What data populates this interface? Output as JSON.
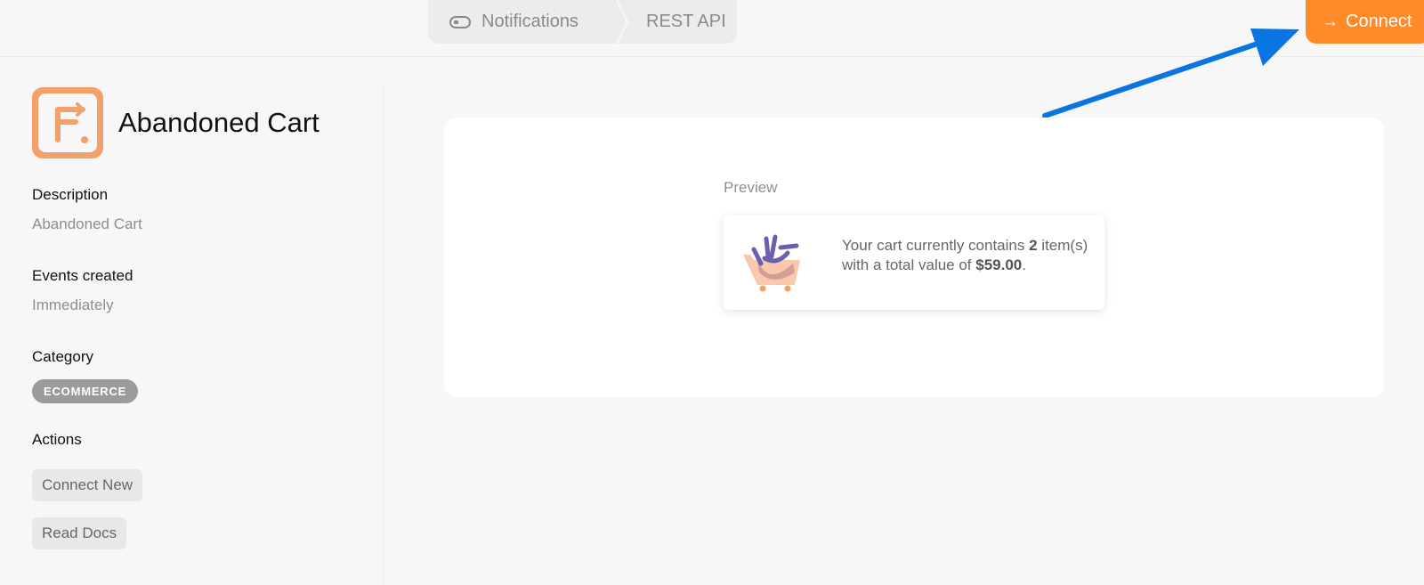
{
  "breadcrumb": {
    "items": [
      {
        "label": "Notifications",
        "icon": "toggle-icon"
      },
      {
        "label": "REST API"
      }
    ]
  },
  "header": {
    "connect_label": "Connect",
    "connect_icon": "arrow-right-icon",
    "accent_color": "#ff8a2a"
  },
  "annotation": {
    "color": "#0a74e0"
  },
  "sidebar": {
    "title": "Abandoned Cart",
    "logo_icon": "brand-logo",
    "description_label": "Description",
    "description_value": "Abandoned Cart",
    "events_label": "Events created",
    "events_value": "Immediately",
    "category_label": "Category",
    "category_badge": "ECOMMERCE",
    "actions_label": "Actions",
    "actions": [
      {
        "label": "Connect New"
      },
      {
        "label": "Read Docs"
      }
    ]
  },
  "preview": {
    "label": "Preview",
    "icon": "shopping-cart-illustration",
    "text_before_count": "Your cart currently contains ",
    "item_count": "2",
    "text_middle": " item(s) with a total value of ",
    "total_value": "$59.00",
    "text_end": "."
  }
}
